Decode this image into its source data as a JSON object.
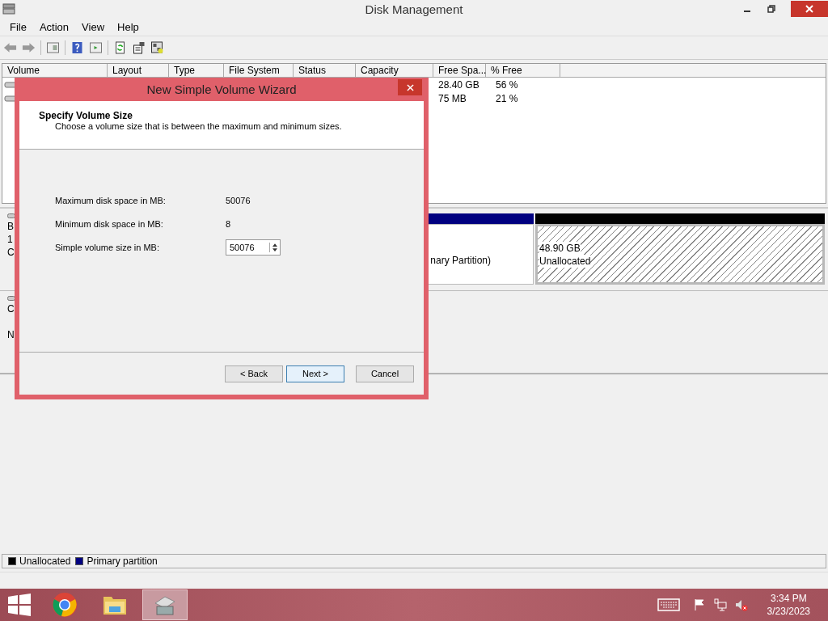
{
  "window": {
    "title": "Disk Management"
  },
  "menu": [
    "File",
    "Action",
    "View",
    "Help"
  ],
  "volume_list": {
    "columns": [
      "Volume",
      "Layout",
      "Type",
      "File System",
      "Status",
      "Capacity",
      "Free Spa...",
      "% Free"
    ],
    "rows": [
      {
        "free_space": "28.40 GB",
        "percent_free": "56 %"
      },
      {
        "free_space": "75 MB",
        "percent_free": "21 %"
      }
    ]
  },
  "disks": [
    {
      "label_lines": [
        "B",
        "1",
        "C"
      ],
      "partitions": [
        {
          "kind": "primary",
          "lines": [
            "nary Partition)"
          ]
        },
        {
          "kind": "unallocated",
          "lines": [
            "48.90 GB",
            "Unallocated"
          ]
        }
      ]
    },
    {
      "label_lines": [
        "C",
        "N"
      ]
    }
  ],
  "legend": [
    {
      "label": "Unallocated",
      "color": "#000000"
    },
    {
      "label": "Primary partition",
      "color": "#000080"
    }
  ],
  "dialog": {
    "title": "New Simple Volume Wizard",
    "heading": "Specify Volume Size",
    "subheading": "Choose a volume size that is between the maximum and minimum sizes.",
    "fields": [
      {
        "kind": "text",
        "label": "Maximum disk space in MB:",
        "value": "50076"
      },
      {
        "kind": "text",
        "label": "Minimum disk space in MB:",
        "value": "8"
      },
      {
        "kind": "spinner",
        "label": "Simple volume size in MB:",
        "value": "50076"
      }
    ],
    "buttons": [
      {
        "label": "< Back",
        "selected": false
      },
      {
        "label": "Next >",
        "selected": true
      },
      {
        "label": "Cancel",
        "selected": false
      }
    ]
  },
  "taskbar": {
    "time": "3:34 PM",
    "date": "3/23/2023"
  }
}
